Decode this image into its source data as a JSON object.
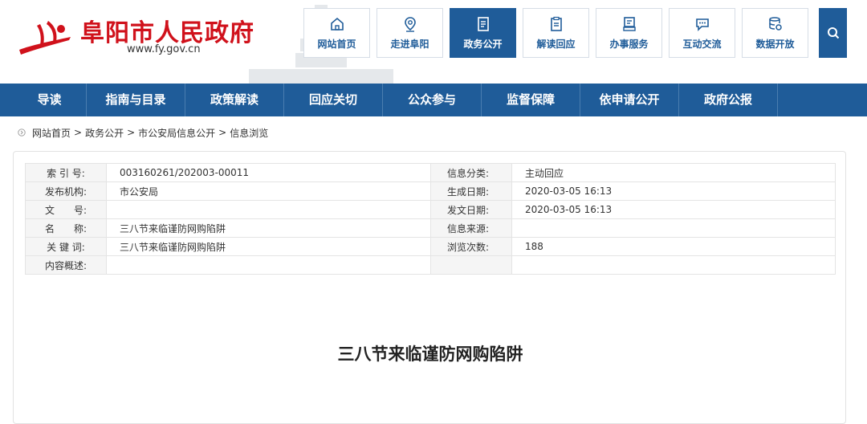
{
  "header": {
    "site_title": "阜阳市人民政府",
    "site_url": "www.fy.gov.cn",
    "nav": [
      {
        "label": "网站首页",
        "icon": "home-icon",
        "active": false
      },
      {
        "label": "走进阜阳",
        "icon": "location-pin-icon",
        "active": false
      },
      {
        "label": "政务公开",
        "icon": "document-icon",
        "active": true
      },
      {
        "label": "解读回应",
        "icon": "clipboard-icon",
        "active": false
      },
      {
        "label": "办事服务",
        "icon": "terminal-icon",
        "active": false
      },
      {
        "label": "互动交流",
        "icon": "chat-bubble-icon",
        "active": false
      },
      {
        "label": "数据开放",
        "icon": "database-icon",
        "active": false
      }
    ],
    "search_icon": "search-icon"
  },
  "mainnav": [
    "导读",
    "指南与目录",
    "政策解读",
    "回应关切",
    "公众参与",
    "监督保障",
    "依申请公开",
    "政府公报"
  ],
  "breadcrumb": {
    "items": [
      "网站首页",
      "政务公开",
      "市公安局信息公开",
      "信息浏览"
    ],
    "separator": ">"
  },
  "info": {
    "rows": [
      {
        "label1": "索 引 号:",
        "value1": "003160261/202003-00011",
        "label2": "信息分类:",
        "value2": "主动回应"
      },
      {
        "label1": "发布机构:",
        "value1": "市公安局",
        "label2": "生成日期:",
        "value2": "2020-03-05 16:13"
      },
      {
        "label1": "文　　号:",
        "value1": "",
        "label2": "发文日期:",
        "value2": "2020-03-05 16:13"
      },
      {
        "label1": "名　　称:",
        "value1": "三八节来临谨防网购陷阱",
        "label2": "信息来源:",
        "value2": ""
      },
      {
        "label1": "关 键 词:",
        "value1": "三八节来临谨防网购陷阱",
        "label2": "浏览次数:",
        "value2": "188"
      },
      {
        "label1": "内容概述:",
        "value1": "",
        "label2": "",
        "value2": ""
      }
    ]
  },
  "article": {
    "title": "三八节来临谨防网购陷阱"
  },
  "colors": {
    "brand_red": "#d0111b",
    "nav_blue": "#1f5c99"
  }
}
